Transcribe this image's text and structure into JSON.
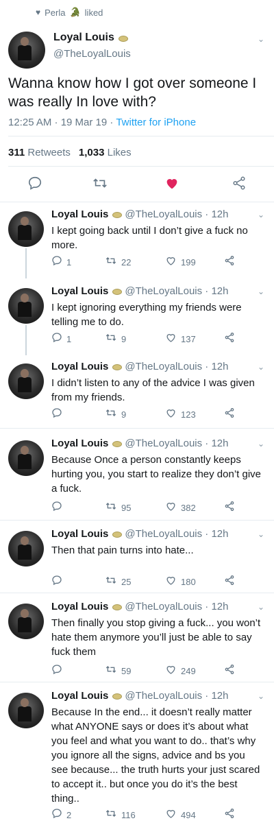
{
  "liked_by": {
    "name": "Perla",
    "emoji": "🐊",
    "suffix": "liked"
  },
  "main": {
    "name": "Loyal Louis",
    "handle": "@TheLoyalLouis",
    "text": "Wanna know how I got over someone I was really In love with?",
    "time": "12:25 AM · 19 Mar 19 · ",
    "source": "Twitter for iPhone",
    "retweets": "311",
    "retweets_label": "Retweets",
    "likes": "1,033",
    "likes_label": "Likes",
    "liked_color": "#e0245e"
  },
  "replies": [
    {
      "name": "Loyal Louis",
      "handle": "@TheLoyalLouis · 12h",
      "text": "I kept going back until I don’t give a fuck no more.",
      "replies": "1",
      "retweets": "22",
      "likes": "199"
    },
    {
      "name": "Loyal Louis",
      "handle": "@TheLoyalLouis · 12h",
      "text": "I kept ignoring everything my friends were telling me to do.",
      "replies": "1",
      "retweets": "9",
      "likes": "137"
    },
    {
      "name": "Loyal Louis",
      "handle": "@TheLoyalLouis · 12h",
      "text": "I didn’t listen to any of the advice I was given from my friends.",
      "replies": "",
      "retweets": "9",
      "likes": "123"
    },
    {
      "name": "Loyal Louis",
      "handle": "@TheLoyalLouis · 12h",
      "text": "Because Once a person constantly keeps hurting you, you start to realize they don’t give a fuck.",
      "replies": "",
      "retweets": "95",
      "likes": "382"
    },
    {
      "name": "Loyal Louis",
      "handle": "@TheLoyalLouis · 12h",
      "text": "Then that pain turns into hate...",
      "replies": "",
      "retweets": "25",
      "likes": "180"
    },
    {
      "name": "Loyal Louis",
      "handle": "@TheLoyalLouis · 12h",
      "text": "Then finally you stop giving a fuck... you won’t hate them anymore you’ll just be able to say fuck them",
      "replies": "",
      "retweets": "59",
      "likes": "249"
    },
    {
      "name": "Loyal Louis",
      "handle": "@TheLoyalLouis · 12h",
      "text": "Because In the end... it doesn’t really matter what ANYONE says or does it’s about what you feel and what you want to do.. that’s why you ignore all the signs, advice and bs you see because... the truth hurts your just scared to accept it.. but once you do it’s the best thing..",
      "replies": "2",
      "retweets": "116",
      "likes": "494"
    }
  ],
  "icons": {
    "reply": "reply-icon",
    "retweet": "retweet-icon",
    "like": "heart-icon",
    "share": "share-icon",
    "chevron": "chevron-down-icon",
    "verified": "crown-badge-icon"
  }
}
